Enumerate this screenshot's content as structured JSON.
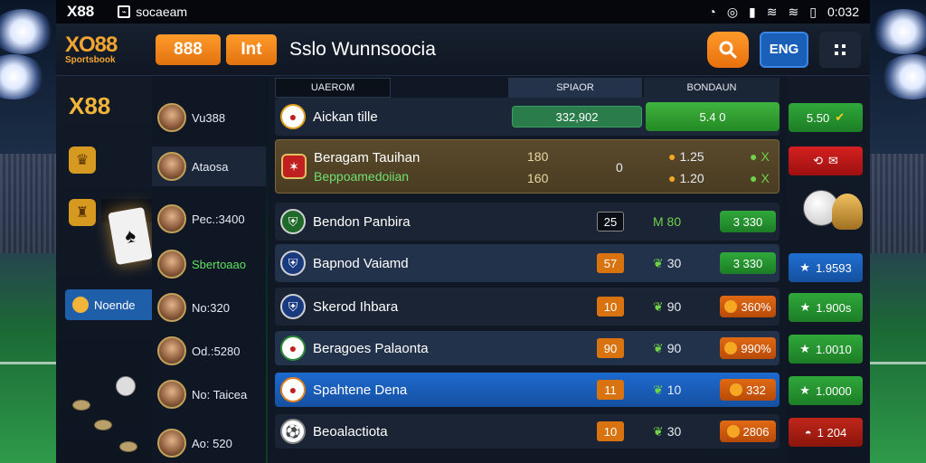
{
  "status_bar": {
    "brand": "X88",
    "app_label": "socaeam",
    "time": "0:032"
  },
  "header": {
    "logo_main": "XO88",
    "logo_sub": "Sportsbook",
    "btn1_label": "888",
    "btn2_label": "Int",
    "title": "Sslo Wunnsoocia",
    "lang_label": "ENG"
  },
  "left_panel": {
    "brand": "X88",
    "novelty_label": "Noende"
  },
  "players": [
    {
      "name": "Vu388"
    },
    {
      "name": "Ataosa"
    },
    {
      "name": "Pec.:3400"
    },
    {
      "name": "Sbertoaao"
    },
    {
      "name": "No:320"
    },
    {
      "name": "Od.:5280"
    },
    {
      "name": "No: Taicea"
    },
    {
      "name": "Ao: 520"
    }
  ],
  "tabs": [
    "UAEROM",
    "SPIAOR",
    "BONDAUN"
  ],
  "featured": {
    "team": "Aickan tille",
    "value1": "332,902",
    "value2": "5.4 0"
  },
  "highlight": {
    "team1": "Beragam Tauihan",
    "team2": "Beppoamedoiian",
    "num1": "180",
    "num2": "160",
    "mid": "0",
    "odd1": "1.25",
    "odd2": "1.20",
    "x1": "X",
    "x2": "X"
  },
  "matches": [
    {
      "team": "Bendon Panbira",
      "num": "25",
      "mid": "M 80",
      "price": "3 330",
      "price_type": "green"
    },
    {
      "team": "Bapnod Vaiamd",
      "num": "57",
      "mid": "30",
      "price": "3 330",
      "price_type": "green"
    },
    {
      "team": "Skerod Ihbara",
      "num": "10",
      "mid": "90",
      "price": "360%",
      "price_type": "orange"
    },
    {
      "team": "Beragoes Palaonta",
      "num": "90",
      "mid": "90",
      "price": "990%",
      "price_type": "orange"
    },
    {
      "team": "Spahtene Dena",
      "num": "11",
      "mid": "10",
      "price": "332",
      "price_type": "orange"
    },
    {
      "team": "Beoalactiota",
      "num": "10",
      "mid": "30",
      "price": "2806",
      "price_type": "orange"
    }
  ],
  "right_panel": {
    "items": [
      "5.50",
      "",
      "1.9593",
      "1.900s",
      "1.0010",
      "1.0000",
      "1 204"
    ]
  }
}
